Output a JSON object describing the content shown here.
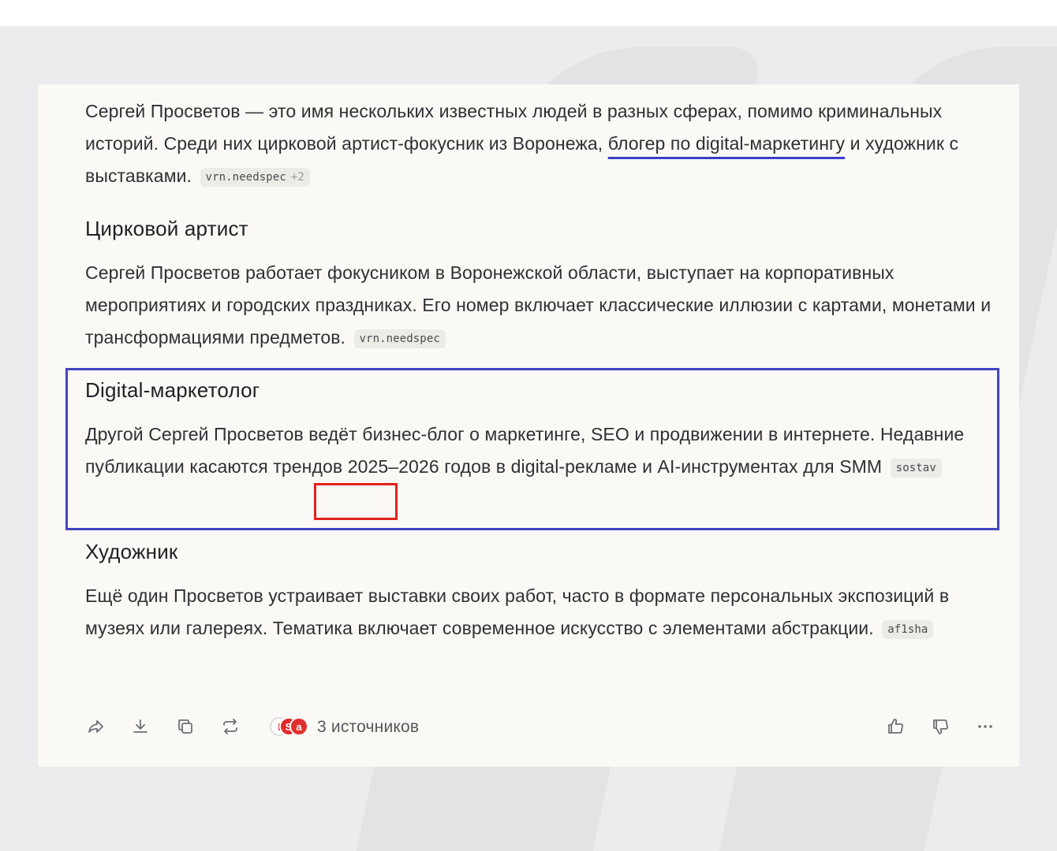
{
  "article": {
    "intro": {
      "text_before": "Сергей Просветов — это имя нескольких известных людей в разных сферах, помимо криминальных историй. Среди них цирковой артист-фокусник из Воронежа, ",
      "link_text": "блогер по digital-маркетингу",
      "text_after": " и художник с выставками.",
      "chip_label": "vrn.needspec",
      "chip_more": "+2"
    },
    "sections": [
      {
        "heading": "Цирковой артист",
        "text": "Сергей Просветов работает фокусником в Воронежской области, выступает на корпоративных мероприятиях и городских праздниках. Его номер включает классические иллюзии с картами, монетами и трансформациями предметов.",
        "chip": "vrn.needspec"
      },
      {
        "heading": "Digital-маркетолог",
        "text": "Другой Сергей Просветов ведёт бизнес-блог о маркетинге, SEO и продвижении в интернете. Недавние публикации касаются трендов 2025–2026 годов в digital-рекламе и AI-инструментах для SMM",
        "chip": "sostav"
      },
      {
        "heading": "Художник",
        "text": "Ещё один Просветов устраивает выставки своих работ, часто в формате персональных экспозиций в музеях или галереях. Тематика включает современное искусство с элементами абстракции.",
        "chip": "af1sha"
      }
    ]
  },
  "toolbar": {
    "icons": [
      "share-icon",
      "download-icon",
      "copy-icon",
      "repeat-icon",
      "thumbs-up-icon",
      "thumbs-down-icon",
      "more-icon"
    ],
    "sources_label": "3 источников",
    "source_logos": [
      "I",
      "S",
      "a"
    ]
  },
  "colors": {
    "highlight_blue": "#4444c2",
    "highlight_red": "#e3211c",
    "link_underline": "#3b3cc9"
  }
}
